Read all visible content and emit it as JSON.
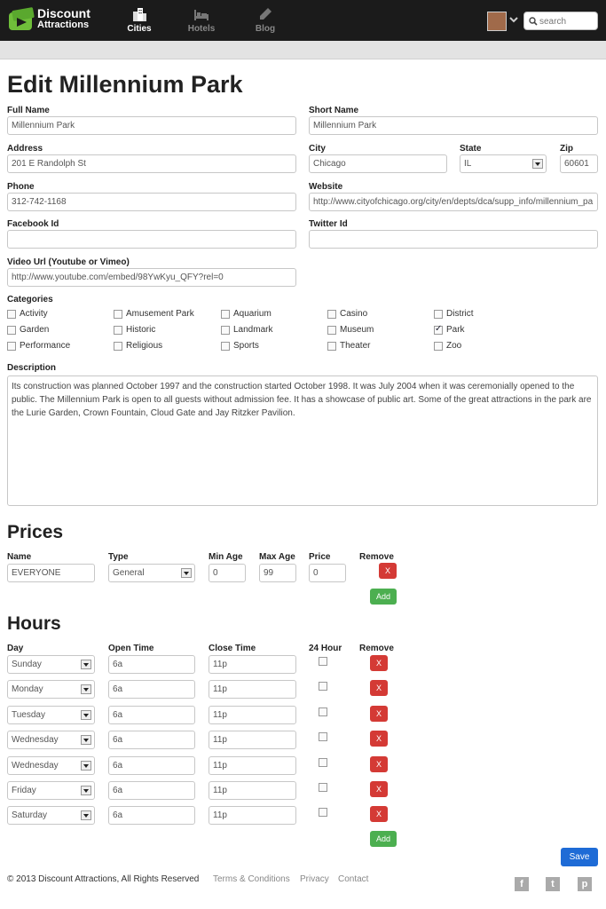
{
  "brand": {
    "line1": "Discount",
    "line2": "Attractions"
  },
  "nav": {
    "cities": "Cities",
    "hotels": "Hotels",
    "blog": "Blog"
  },
  "search": {
    "placeholder": "search"
  },
  "page": {
    "title": "Edit Millennium Park"
  },
  "form": {
    "full_name": {
      "label": "Full Name",
      "value": "Millennium Park"
    },
    "short_name": {
      "label": "Short Name",
      "value": "Millennium Park"
    },
    "address": {
      "label": "Address",
      "value": "201 E Randolph St"
    },
    "city": {
      "label": "City",
      "value": "Chicago"
    },
    "state": {
      "label": "State",
      "value": "IL"
    },
    "zip": {
      "label": "Zip",
      "value": "60601"
    },
    "phone": {
      "label": "Phone",
      "value": "312-742-1168"
    },
    "website": {
      "label": "Website",
      "value": "http://www.cityofchicago.org/city/en/depts/dca/supp_info/millennium_pa"
    },
    "facebook": {
      "label": "Facebook Id",
      "value": ""
    },
    "twitter": {
      "label": "Twitter Id",
      "value": ""
    },
    "video": {
      "label": "Video Url (Youtube or Vimeo)",
      "value": "http://www.youtube.com/embed/98YwKyu_QFY?rel=0"
    },
    "categories_label": "Categories",
    "categories": [
      {
        "name": "Activity",
        "checked": false
      },
      {
        "name": "Amusement Park",
        "checked": false
      },
      {
        "name": "Aquarium",
        "checked": false
      },
      {
        "name": "Casino",
        "checked": false
      },
      {
        "name": "District",
        "checked": false
      },
      {
        "name": "Garden",
        "checked": false
      },
      {
        "name": "Historic",
        "checked": false
      },
      {
        "name": "Landmark",
        "checked": false
      },
      {
        "name": "Museum",
        "checked": false
      },
      {
        "name": "Park",
        "checked": true
      },
      {
        "name": "Performance",
        "checked": false
      },
      {
        "name": "Religious",
        "checked": false
      },
      {
        "name": "Sports",
        "checked": false
      },
      {
        "name": "Theater",
        "checked": false
      },
      {
        "name": "Zoo",
        "checked": false
      }
    ],
    "description_label": "Description",
    "description": "Its construction was planned October 1997 and the construction started October 1998. It was July 2004 when it was ceremonially opened to the public. The Millennium Park is open to all guests without admission fee. It has a showcase of public art. Some of the  great attractions in the park are the Lurie Garden, Crown Fountain, Cloud Gate and Jay Ritzker Pavilion."
  },
  "prices": {
    "title": "Prices",
    "headers": {
      "name": "Name",
      "type": "Type",
      "min_age": "Min Age",
      "max_age": "Max Age",
      "price": "Price",
      "remove": "Remove"
    },
    "rows": [
      {
        "name": "EVERYONE",
        "type": "General",
        "min_age": "0",
        "max_age": "99",
        "price": "0"
      }
    ],
    "remove_label": "X",
    "add_label": "Add"
  },
  "hours": {
    "title": "Hours",
    "headers": {
      "day": "Day",
      "open": "Open Time",
      "close": "Close Time",
      "h24": "24 Hour",
      "remove": "Remove"
    },
    "rows": [
      {
        "day": "Sunday",
        "open": "6a",
        "close": "11p"
      },
      {
        "day": "Monday",
        "open": "6a",
        "close": "11p"
      },
      {
        "day": "Tuesday",
        "open": "6a",
        "close": "11p"
      },
      {
        "day": "Wednesday",
        "open": "6a",
        "close": "11p"
      },
      {
        "day": "Wednesday",
        "open": "6a",
        "close": "11p"
      },
      {
        "day": "Friday",
        "open": "6a",
        "close": "11p"
      },
      {
        "day": "Saturday",
        "open": "6a",
        "close": "11p"
      }
    ],
    "remove_label": "X",
    "add_label": "Add"
  },
  "save_label": "Save",
  "footer": {
    "copyright": "© 2013 Discount Attractions, All Rights Reserved",
    "terms": "Terms & Conditions",
    "privacy": "Privacy",
    "contact": "Contact",
    "social": [
      "f",
      "t",
      "p"
    ]
  }
}
